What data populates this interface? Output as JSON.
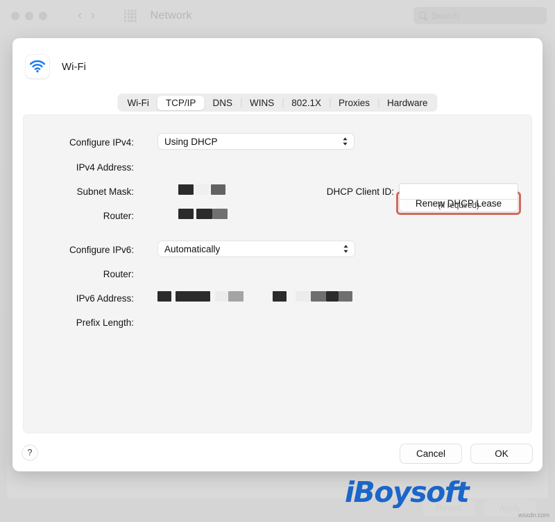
{
  "window": {
    "title": "Network",
    "search_placeholder": "Search",
    "ghost_buttons": [
      "Revert",
      "Apply"
    ]
  },
  "sheet": {
    "service_name": "Wi-Fi",
    "service_icon": "wifi-icon",
    "tabs": [
      {
        "label": "Wi-Fi",
        "active": false
      },
      {
        "label": "TCP/IP",
        "active": true
      },
      {
        "label": "DNS",
        "active": false
      },
      {
        "label": "WINS",
        "active": false
      },
      {
        "label": "802.1X",
        "active": false
      },
      {
        "label": "Proxies",
        "active": false
      },
      {
        "label": "Hardware",
        "active": false
      }
    ],
    "ipv4": {
      "configure_label": "Configure IPv4:",
      "configure_value": "Using DHCP",
      "address_label": "IPv4 Address:",
      "address_value": "",
      "subnet_label": "Subnet Mask:",
      "subnet_value": "",
      "router_label": "Router:",
      "router_value": ""
    },
    "dhcp": {
      "renew_button": "Renew DHCP Lease",
      "client_id_label": "DHCP Client ID:",
      "client_id_value": "",
      "client_id_hint": "(If required)",
      "highlight_color": "#d0695f"
    },
    "ipv6": {
      "configure_label": "Configure IPv6:",
      "configure_value": "Automatically",
      "router_label": "Router:",
      "router_value": "",
      "address_label": "IPv6 Address:",
      "address_value": "",
      "prefix_label": "Prefix Length:",
      "prefix_value": ""
    },
    "footer": {
      "help": "?",
      "cancel": "Cancel",
      "ok": "OK"
    }
  },
  "watermark": {
    "brand": "iBoysoft",
    "source": "wsxdn.com"
  }
}
